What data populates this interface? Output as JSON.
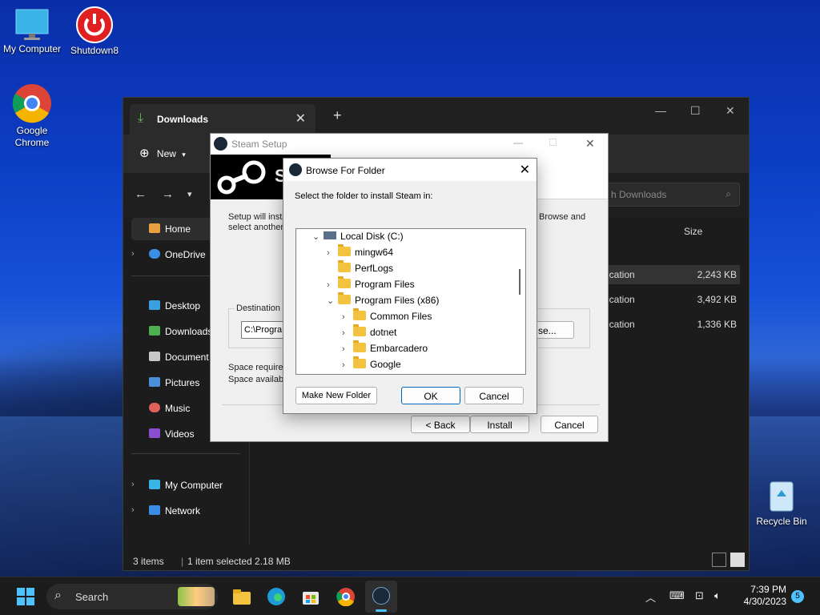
{
  "desktop": {
    "icons": {
      "my_computer": "My Computer",
      "shutdown": "Shutdown8",
      "chrome_line1": "Google",
      "chrome_line2": "Chrome",
      "recycle_bin": "Recycle Bin"
    }
  },
  "explorer": {
    "tab_title": "Downloads",
    "tab_close": "✕",
    "new_tab": "+",
    "toolbar_new": "New",
    "search_placeholder": "h Downloads",
    "columns": {
      "size": "Size"
    },
    "files": [
      {
        "type": "ication",
        "size": "2,243 KB"
      },
      {
        "type": "ication",
        "size": "3,492 KB"
      },
      {
        "type": "ication",
        "size": "1,336 KB"
      }
    ],
    "sidebar": {
      "home": "Home",
      "onedrive": "OneDrive",
      "desktop": "Desktop",
      "downloads": "Downloads",
      "documents": "Document",
      "pictures": "Pictures",
      "music": "Music",
      "videos": "Videos",
      "my_computer": "My Computer",
      "network": "Network"
    },
    "status": {
      "items": "3 items",
      "selected": "1 item selected  2.18 MB"
    }
  },
  "steam_setup": {
    "title": "Steam Setup",
    "banner_letter": "S",
    "text_setup_1": "Setup will insta",
    "text_setup_2": "select another",
    "text_browse_hint": "Browse and",
    "destination_label": "Destination I",
    "path_value": "C:\\Progra",
    "browse_button": "se...",
    "space_required": "Space require",
    "space_available": "Space availab",
    "back_button": "< Back",
    "install_button": "Install",
    "cancel_button": "Cancel"
  },
  "browse_dialog": {
    "title": "Browse For Folder",
    "close": "✕",
    "prompt": "Select the folder to install Steam in:",
    "tree": [
      {
        "label": "Local Disk (C:)",
        "level": 0,
        "expander": "down",
        "kind": "drive"
      },
      {
        "label": "mingw64",
        "level": 1,
        "expander": "right",
        "kind": "folder"
      },
      {
        "label": "PerfLogs",
        "level": 1,
        "expander": "none",
        "kind": "folder"
      },
      {
        "label": "Program Files",
        "level": 1,
        "expander": "right",
        "kind": "folder"
      },
      {
        "label": "Program Files (x86)",
        "level": 1,
        "expander": "down",
        "kind": "folder"
      },
      {
        "label": "Common Files",
        "level": 2,
        "expander": "right",
        "kind": "folder"
      },
      {
        "label": "dotnet",
        "level": 2,
        "expander": "right",
        "kind": "folder"
      },
      {
        "label": "Embarcadero",
        "level": 2,
        "expander": "right",
        "kind": "folder"
      },
      {
        "label": "Google",
        "level": 2,
        "expander": "right",
        "kind": "folder"
      }
    ],
    "make_new_folder": "Make New Folder",
    "ok": "OK",
    "cancel": "Cancel"
  },
  "taskbar": {
    "search_label": "Search",
    "time": "7:39 PM",
    "date": "4/30/2023",
    "notification_count": "5"
  },
  "colors": {
    "accent": "#0067c0",
    "folder": "#f3c33f",
    "dark_bg": "#1c1c1c"
  }
}
